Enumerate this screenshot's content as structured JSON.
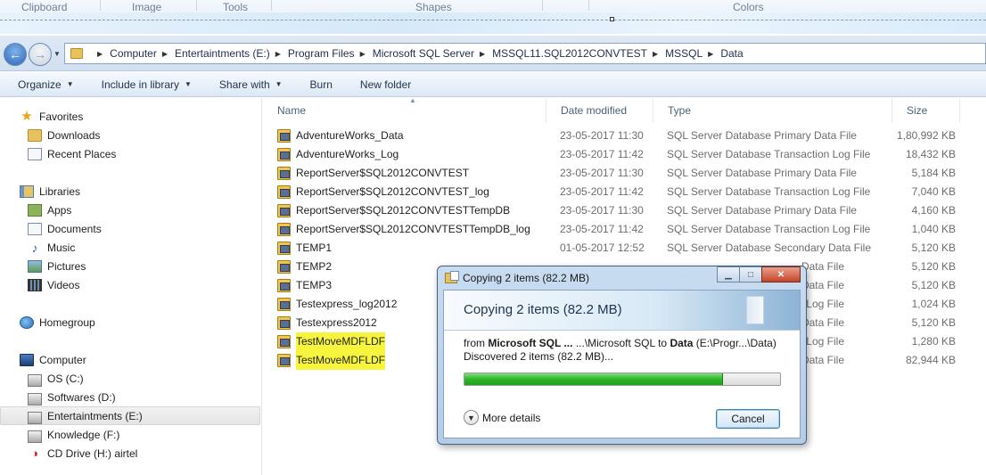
{
  "ribbon": {
    "groups": [
      "Clipboard",
      "Image",
      "Tools",
      "Shapes",
      "Colors"
    ]
  },
  "address": {
    "crumbs": [
      "Computer",
      "Entertaintments (E:)",
      "Program Files",
      "Microsoft SQL Server",
      "MSSQL11.SQL2012CONVTEST",
      "MSSQL",
      "Data"
    ]
  },
  "toolbar": {
    "organize": "Organize",
    "include": "Include in library",
    "share": "Share with",
    "burn": "Burn",
    "new_folder": "New folder"
  },
  "sidebar": {
    "favorites": "Favorites",
    "downloads": "Downloads",
    "recent": "Recent Places",
    "libraries": "Libraries",
    "apps": "Apps",
    "documents": "Documents",
    "music": "Music",
    "pictures": "Pictures",
    "videos": "Videos",
    "homegroup": "Homegroup",
    "computer": "Computer",
    "os": "OS (C:)",
    "softwares": "Softwares (D:)",
    "entertainments": "Entertaintments (E:)",
    "knowledge": "Knowledge (F:)",
    "cd": "CD Drive (H:) airtel"
  },
  "columns": {
    "name": "Name",
    "date": "Date modified",
    "type": "Type",
    "size": "Size"
  },
  "files": [
    {
      "name": "AdventureWorks_Data",
      "date": "23-05-2017 11:30",
      "type": "SQL Server Database Primary Data File",
      "size": "1,80,992 KB"
    },
    {
      "name": "AdventureWorks_Log",
      "date": "23-05-2017 11:42",
      "type": "SQL Server Database Transaction Log File",
      "size": "18,432 KB"
    },
    {
      "name": "ReportServer$SQL2012CONVTEST",
      "date": "23-05-2017 11:30",
      "type": "SQL Server Database Primary Data File",
      "size": "5,184 KB"
    },
    {
      "name": "ReportServer$SQL2012CONVTEST_log",
      "date": "23-05-2017 11:42",
      "type": "SQL Server Database Transaction Log File",
      "size": "7,040 KB"
    },
    {
      "name": "ReportServer$SQL2012CONVTESTTempDB",
      "date": "23-05-2017 11:30",
      "type": "SQL Server Database Primary Data File",
      "size": "4,160 KB"
    },
    {
      "name": "ReportServer$SQL2012CONVTESTTempDB_log",
      "date": "23-05-2017 11:42",
      "type": "SQL Server Database Transaction Log File",
      "size": "1,040 KB"
    },
    {
      "name": "TEMP1",
      "date": "01-05-2017 12:52",
      "type": "SQL Server Database Secondary Data File",
      "size": "5,120 KB"
    },
    {
      "name": "TEMP2",
      "date": "",
      "type": "Data File",
      "size": "5,120 KB"
    },
    {
      "name": "TEMP3",
      "date": "",
      "type": "Data File",
      "size": "5,120 KB"
    },
    {
      "name": "Testexpress_log2012",
      "date": "",
      "type": "on Log File",
      "size": "1,024 KB"
    },
    {
      "name": "Testexpress2012",
      "date": "",
      "type": "Data File",
      "size": "5,120 KB"
    },
    {
      "name": "TestMoveMDFLDF",
      "date": "",
      "type": "on Log File",
      "size": "1,280 KB"
    },
    {
      "name": "TestMoveMDFLDF",
      "date": "",
      "type": "Data File",
      "size": "82,944 KB"
    }
  ],
  "dialog": {
    "title": "Copying 2 items (82.2 MB)",
    "heading": "Copying 2 items (82.2 MB)",
    "from_label": "from",
    "from_src": "Microsoft SQL ...",
    "from_path": "...\\Microsoft SQL",
    "to_label": "to",
    "to_dest": "Data",
    "to_path": "(E:\\Progr...\\Data)",
    "discovered": "Discovered 2 items (82.2 MB)...",
    "progress": 0.82,
    "more_details": "More details",
    "cancel": "Cancel"
  }
}
